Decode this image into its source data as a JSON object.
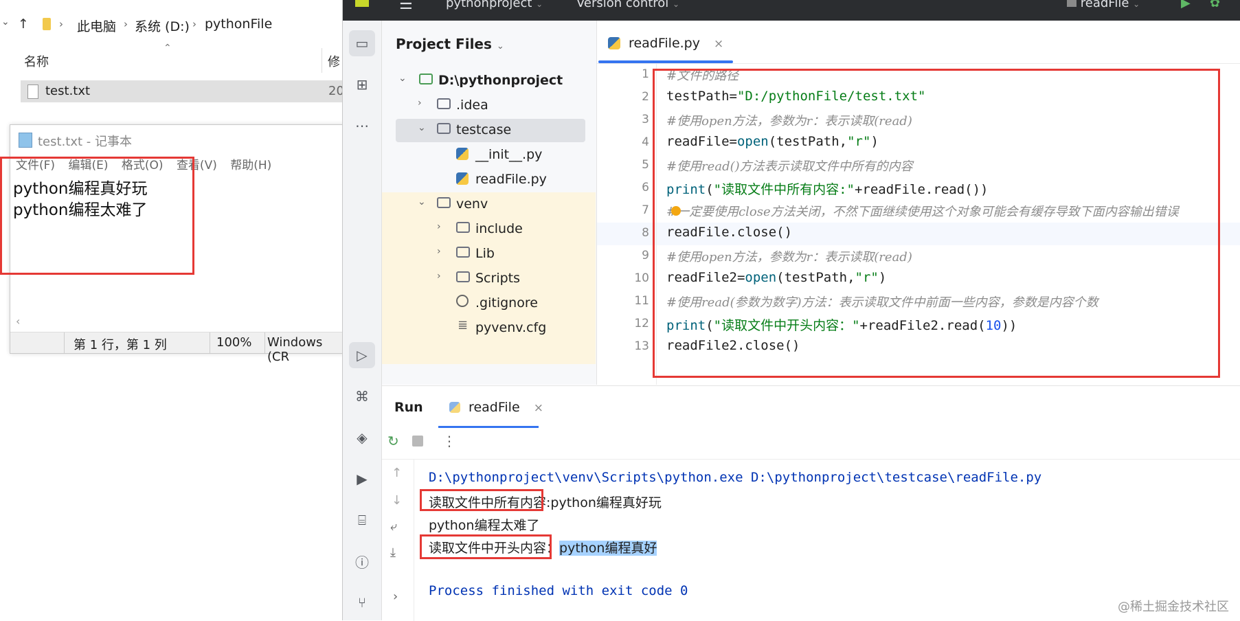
{
  "explorer": {
    "breadcrumb": [
      "此电脑",
      "系统 (D:)",
      "pythonFile"
    ],
    "column_name": "名称",
    "column_modified": "修",
    "file": {
      "name": "test.txt",
      "date": "20"
    }
  },
  "notepad": {
    "title": "test.txt - 记事本",
    "menu": [
      "文件(F)",
      "编辑(E)",
      "格式(O)",
      "查看(V)",
      "帮助(H)"
    ],
    "lines": [
      "python编程真好玩",
      "python编程太难了"
    ],
    "status": {
      "position": "第 1 行，第 1 列",
      "zoom": "100%",
      "eol": "Windows (CR"
    }
  },
  "ide": {
    "topbar": {
      "project": "pythonproject",
      "vcs": "Version control",
      "run_config": "readFile"
    },
    "project_pane": {
      "title": "Project Files",
      "tree": [
        {
          "label": "D:\\pythonproject",
          "depth": 0,
          "type": "root",
          "expanded": true
        },
        {
          "label": ".idea",
          "depth": 1,
          "type": "folder",
          "expanded": false
        },
        {
          "label": "testcase",
          "depth": 1,
          "type": "package",
          "expanded": true,
          "selected": true
        },
        {
          "label": "__init__.py",
          "depth": 2,
          "type": "python"
        },
        {
          "label": "readFile.py",
          "depth": 2,
          "type": "python"
        },
        {
          "label": "venv",
          "depth": 1,
          "type": "folder",
          "expanded": true
        },
        {
          "label": "include",
          "depth": 2,
          "type": "folder",
          "expanded": false
        },
        {
          "label": "Lib",
          "depth": 2,
          "type": "folder",
          "expanded": false
        },
        {
          "label": "Scripts",
          "depth": 2,
          "type": "folder",
          "expanded": false
        },
        {
          "label": ".gitignore",
          "depth": 2,
          "type": "ignore"
        },
        {
          "label": "pyvenv.cfg",
          "depth": 2,
          "type": "config"
        }
      ]
    },
    "editor": {
      "tab": "readFile.py",
      "lines": [
        {
          "n": "1",
          "text": "#文件的路径"
        },
        {
          "n": "2",
          "text": "testPath=\"D:/pythonFile/test.txt\""
        },
        {
          "n": "3",
          "text": "#使用open方法，参数为r：表示读取(read)"
        },
        {
          "n": "4",
          "text": "readFile=open(testPath,\"r\")"
        },
        {
          "n": "5",
          "text": "#使用read()方法表示读取文件中所有的内容"
        },
        {
          "n": "6",
          "text": "print(\"读取文件中所有内容:\"+readFile.read())"
        },
        {
          "n": "7",
          "text": "#一定要使用close方法关闭，不然下面继续使用这个对象可能会有缓存导致下面内容输出错误"
        },
        {
          "n": "8",
          "text": "readFile.close()"
        },
        {
          "n": "9",
          "text": "#使用open方法，参数为r：表示读取(read)"
        },
        {
          "n": "10",
          "text": "readFile2=open(testPath,\"r\")"
        },
        {
          "n": "11",
          "text": "#使用read(参数为数字)方法：表示读取文件中前面一些内容，参数是内容个数"
        },
        {
          "n": "12",
          "text": "print(\"读取文件中开头内容：\"+readFile2.read(10))"
        },
        {
          "n": "13",
          "text": "readFile2.close()"
        }
      ]
    },
    "run": {
      "title": "Run",
      "tab": "readFile",
      "output": [
        "D:\\pythonproject\\venv\\Scripts\\python.exe D:\\pythonproject\\testcase\\readFile.py",
        "读取文件中所有内容:python编程真好玩",
        "python编程太难了",
        "读取文件中开头内容：python编程真好",
        "",
        "Process finished with exit code 0"
      ],
      "out3_prefix": "读取文件中开头内容：",
      "out3_selected": "python编程真好"
    },
    "watermark": "@稀土掘金技术社区"
  }
}
